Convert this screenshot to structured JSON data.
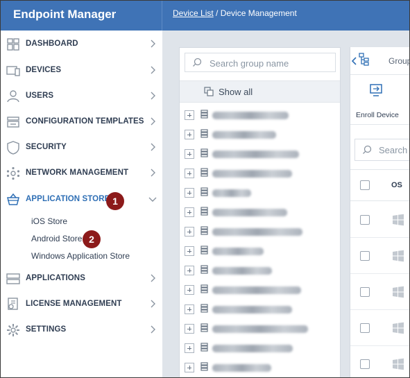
{
  "app": {
    "title": "Endpoint Manager"
  },
  "breadcrumb": {
    "link": "Device List",
    "separator": "/",
    "current": "Device Management"
  },
  "sidebar": {
    "items": [
      {
        "label": "DASHBOARD",
        "icon": "dashboard-icon"
      },
      {
        "label": "DEVICES",
        "icon": "devices-icon"
      },
      {
        "label": "USERS",
        "icon": "user-icon"
      },
      {
        "label": "CONFIGURATION TEMPLATES",
        "icon": "templates-icon"
      },
      {
        "label": "SECURITY",
        "icon": "shield-icon"
      },
      {
        "label": "NETWORK MANAGEMENT",
        "icon": "network-icon"
      },
      {
        "label": "APPLICATION STORE",
        "icon": "basket-icon",
        "expanded": true
      },
      {
        "label": "APPLICATIONS",
        "icon": "applications-icon"
      },
      {
        "label": "LICENSE MANAGEMENT",
        "icon": "license-icon"
      },
      {
        "label": "SETTINGS",
        "icon": "gear-icon"
      }
    ],
    "subitems": [
      "iOS Store",
      "Android Store",
      "Windows Application Store"
    ]
  },
  "annotations": {
    "badge1": "1",
    "badge2": "2"
  },
  "groups": {
    "search_placeholder": "Search group name",
    "show_all": "Show all",
    "row_count": 14
  },
  "device_panel": {
    "group_tab_label": "Group",
    "enroll_label": "Enroll Device",
    "search_placeholder": "Search",
    "column_os": "OS",
    "row_count": 5
  },
  "colors": {
    "topbar": "#3f73b6",
    "active": "#2f6fb5",
    "badge": "#8c1a1a"
  }
}
